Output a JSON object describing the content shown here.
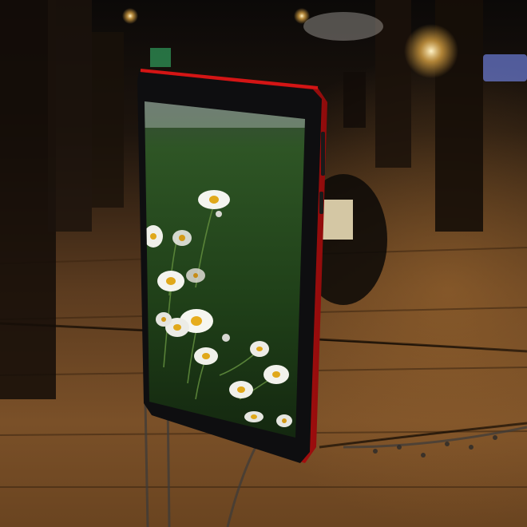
{
  "scene": {
    "description_subject": "tablet",
    "device_color": "#d41515",
    "screen_wallpaper": "daisy-flowers-on-green-grass",
    "background": "dim-warehouse-interior-with-wooden-floor",
    "colors": {
      "floor_warm": "#7a5028",
      "floor_dark": "#2a1a0e",
      "bezel": "#0e0e10",
      "grass": "#2f5a22",
      "daisy_petal": "#f4f4ef",
      "daisy_center": "#e0a81a"
    }
  }
}
